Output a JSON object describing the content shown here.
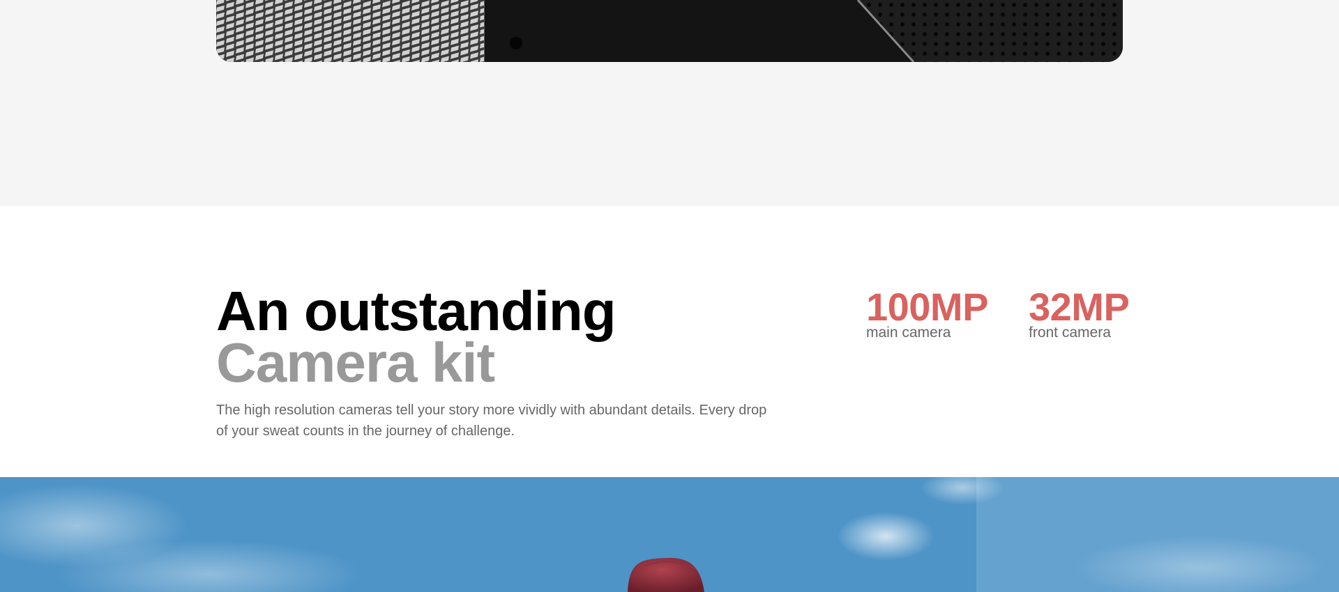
{
  "headline": {
    "line1": "An outstanding",
    "line2": "Camera kit"
  },
  "description": "The high resolution cameras tell your story more vividly with abundant details. Every drop of your sweat counts in the journey of challenge.",
  "specs": [
    {
      "value": "100MP",
      "label": "main camera"
    },
    {
      "value": "32MP",
      "label": "front camera"
    }
  ],
  "colors": {
    "accent": "#d9625f",
    "headline_secondary": "#999999",
    "body_text": "#666666",
    "gray_band": "#f5f5f5",
    "sky": "#4f95c8"
  }
}
